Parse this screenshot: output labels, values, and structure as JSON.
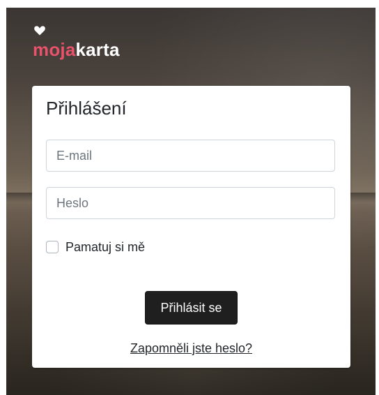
{
  "brand": {
    "logo_part1": "moja",
    "logo_part2": "karta",
    "heart_icon": "heart-icon",
    "accent_color": "#e8526a"
  },
  "login": {
    "title": "Přihlášení",
    "email_placeholder": "E-mail",
    "password_placeholder": "Heslo",
    "remember_label": "Pamatuj si mě",
    "remember_checked": false,
    "submit_label": "Přihlásit se",
    "forgot_link": "Zapomněli jste heslo?"
  }
}
